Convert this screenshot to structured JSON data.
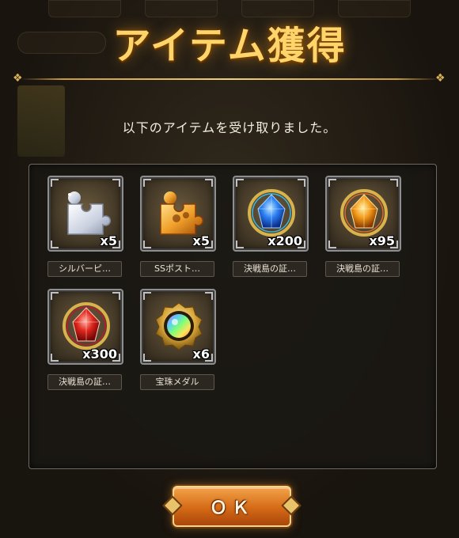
{
  "dialog": {
    "title": "アイテム獲得",
    "message": "以下のアイテムを受け取りました。",
    "ok_label": "ＯＫ"
  },
  "items": [
    {
      "name": "シルバーピ…",
      "quantity": "x5",
      "icon": "silver-puzzle-piece-icon"
    },
    {
      "name": "SSポスト…",
      "quantity": "x5",
      "icon": "orange-puzzle-piece-icon"
    },
    {
      "name": "決戦島の証…",
      "quantity": "x200",
      "icon": "blue-crystal-emblem-icon"
    },
    {
      "name": "決戦島の証…",
      "quantity": "x95",
      "icon": "orange-crystal-emblem-icon"
    },
    {
      "name": "決戦島の証…",
      "quantity": "x300",
      "icon": "red-crystal-emblem-icon"
    },
    {
      "name": "宝珠メダル",
      "quantity": "x6",
      "icon": "rainbow-orb-medal-icon"
    }
  ],
  "colors": {
    "title_gold": "#ffd46a",
    "button_orange": "#d56a16",
    "panel_bg": "#1a1814"
  }
}
